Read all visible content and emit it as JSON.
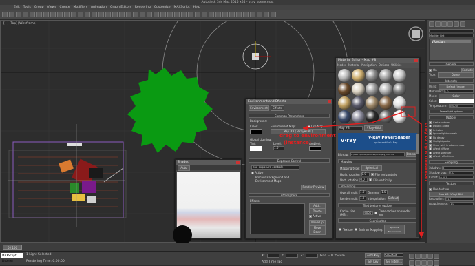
{
  "app": {
    "title": "Autodesk 3ds Max 2015 x64 - vray_scene.max"
  },
  "menu": [
    "Edit",
    "Tools",
    "Group",
    "Views",
    "Create",
    "Modifiers",
    "Animation",
    "Graph Editors",
    "Rendering",
    "Customize",
    "MAXScript",
    "Help"
  ],
  "viewport": {
    "label": "[+] [Top] [Wireframe]"
  },
  "env_dialog": {
    "title": "Environment and Effects",
    "tabs": [
      "Environment",
      "Effects"
    ],
    "common_params": "Common Parameters",
    "background": "Background:",
    "color": "Color:",
    "env_map": "Environment Map:",
    "use_map": "Use Map",
    "map_name": "Map #8 ( VRayHDRI )",
    "global_lighting": "Global Lighting:",
    "tint": "Tint:",
    "level": "Level:",
    "level_value": "1.0",
    "ambient": "Ambient:",
    "exposure": "Exposure Control",
    "exposure_select": "<no exposure control>",
    "active": "Active",
    "process_bg": "Process Background and Environment Maps",
    "render_preview": "Render Preview",
    "atmosphere": "Atmosphere",
    "effects": "Effects:",
    "add": "Add...",
    "delete": "Delete",
    "active2": "Active",
    "move_up": "Move Up",
    "move_down": "Move Down"
  },
  "mini_window": {
    "title": "Shaded",
    "tab": "Auto"
  },
  "mat_editor": {
    "title": "Material Editor - Map #8",
    "menu": [
      "Modes",
      "Material",
      "Navigation",
      "Options",
      "Utilities"
    ],
    "map_field": "Map #8",
    "map_type": "VRayHDRI",
    "banner_logo": "v·ray",
    "banner_title": "V-Ray PowerShader",
    "banner_sub": "optimized for V-Ray",
    "bitmap_label": "Bitmap:",
    "bitmap_path": "C:\\Users\\Public\\Pictures\\HDRI\\sky_hdri.hdr",
    "browse": "Browse",
    "mapping": "Mapping",
    "mapping_type_label": "Mapping type:",
    "mapping_type": "Spherical",
    "horiz_rot": "Horiz. rotation",
    "horiz_val": "0.0",
    "flip_h": "Flip horizontally",
    "vert_rot": "Vert. rotation",
    "vert_val": "0.0",
    "flip_v": "Flip vertically",
    "processing": "Processing",
    "overall_mult": "Overall mult:",
    "overall_val": "1.0",
    "gamma": "Gamma:",
    "gamma_val": "1.0",
    "render_mult": "Render mult:",
    "render_val": "1.0",
    "interp": "Interpolation:",
    "interp_val": "Default",
    "tiled": "Tiled textures options",
    "cache": "Cache size (MB):",
    "cache_val": "4000",
    "clear": "Clear caches on render end",
    "coordinates": "Coordinates",
    "texture": "Texture",
    "environ": "Environ",
    "mapping2": "Mapping:",
    "mapping2_val": "Spherical Environment"
  },
  "annotations": {
    "drag_to_env": "drag to environment",
    "instance": "(instance)",
    "drag_to_light": "drag to light (instance)"
  },
  "cmd_panel": {
    "modifier_list": "Modifier List",
    "object": "VRayLight",
    "general": "General",
    "on": "On",
    "exclude": "Exclude",
    "type": "Type:",
    "type_val": "Dome",
    "intensity": "Intensity",
    "units": "Units:",
    "units_val": "Default (image)",
    "multiplier": "Multiplier:",
    "mult_val": "1.0",
    "mode": "Mode:",
    "mode_val": "Color",
    "color": "Color:",
    "temperature": "Temperature:",
    "temp_val": "6500.0",
    "dome_options": "Dome light options",
    "options": "Options",
    "opts": [
      "Cast shadows",
      "Double-sided",
      "Invisible",
      "Ignore light normals",
      "No decay",
      "Skylight portal",
      "Store with irradiance map",
      "Affect diffuse",
      "Affect specular",
      "Affect reflections"
    ],
    "sampling": "Sampling",
    "subdivs": "Subdivs:",
    "subdivs_val": "8",
    "shadow_bias": "Shadow bias:",
    "shadow_bias_val": "0.02",
    "cutoff": "Cutoff:",
    "cutoff_val": "0.001",
    "texture": "Texture",
    "use_texture": "Use texture",
    "tex_map": "Map #8 (VRayHDRI)",
    "resolution": "Resolution:",
    "res_val": "512",
    "adaptiveness": "Adaptiveness:",
    "adapt_val": "1.0"
  },
  "timeline": {
    "frame": "0 / 100"
  },
  "status": {
    "selection": "1 Light Selected",
    "prompt": "Rendering Time: 0:00:00",
    "maxscript": "MAXScript Listener",
    "x": "X:",
    "y": "Y:",
    "z": "Z:",
    "grid": "Grid = 0.254cm",
    "auto_key": "Auto Key",
    "selected": "Selected",
    "set_key": "Set Key",
    "key_filters": "Key Filters...",
    "time_tag": "Add Time Tag"
  },
  "colors": {
    "tree": "#0a9a12",
    "annotation": "#e02020",
    "vray_blue": "#1c4e8a"
  }
}
